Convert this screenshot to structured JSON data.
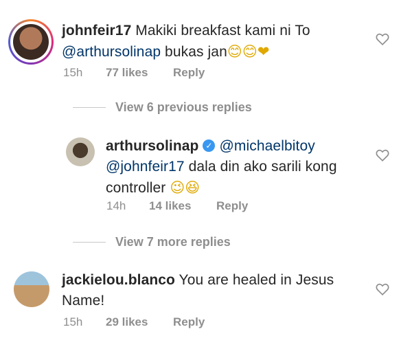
{
  "comments": [
    {
      "username": "johnfeir17",
      "text_line1": "Makiki breakfast kami ni To",
      "mention": "@arthursolinap",
      "text_line2": " bukas jan",
      "emojis": "😊😊❤",
      "time": "15h",
      "likes": "77 likes",
      "reply": "Reply",
      "heart_icon": "heart-outline-icon"
    },
    {
      "view_replies": "View 6 previous replies"
    },
    {
      "username": "arthursolinap",
      "verified": true,
      "mention_a": "@michaelbitoy",
      "mention_b": "@johnfeir17",
      "text_a": " dala din ako sarili kong",
      "text_b": "controller ",
      "emojis": "😉😆",
      "time": "14h",
      "likes": "14 likes",
      "reply": "Reply",
      "heart_icon": "heart-outline-icon"
    },
    {
      "view_replies": "View 7 more replies"
    },
    {
      "username": "jackielou.blanco",
      "text_line1": " You are healed in Jesus",
      "text_line2": "Name!",
      "time": "15h",
      "likes": "29 likes",
      "reply": "Reply",
      "heart_icon": "heart-outline-icon"
    }
  ],
  "colors": {
    "text": "#262626",
    "muted": "#8e8e8e",
    "mention": "#003569",
    "verified": "#3897f0"
  }
}
